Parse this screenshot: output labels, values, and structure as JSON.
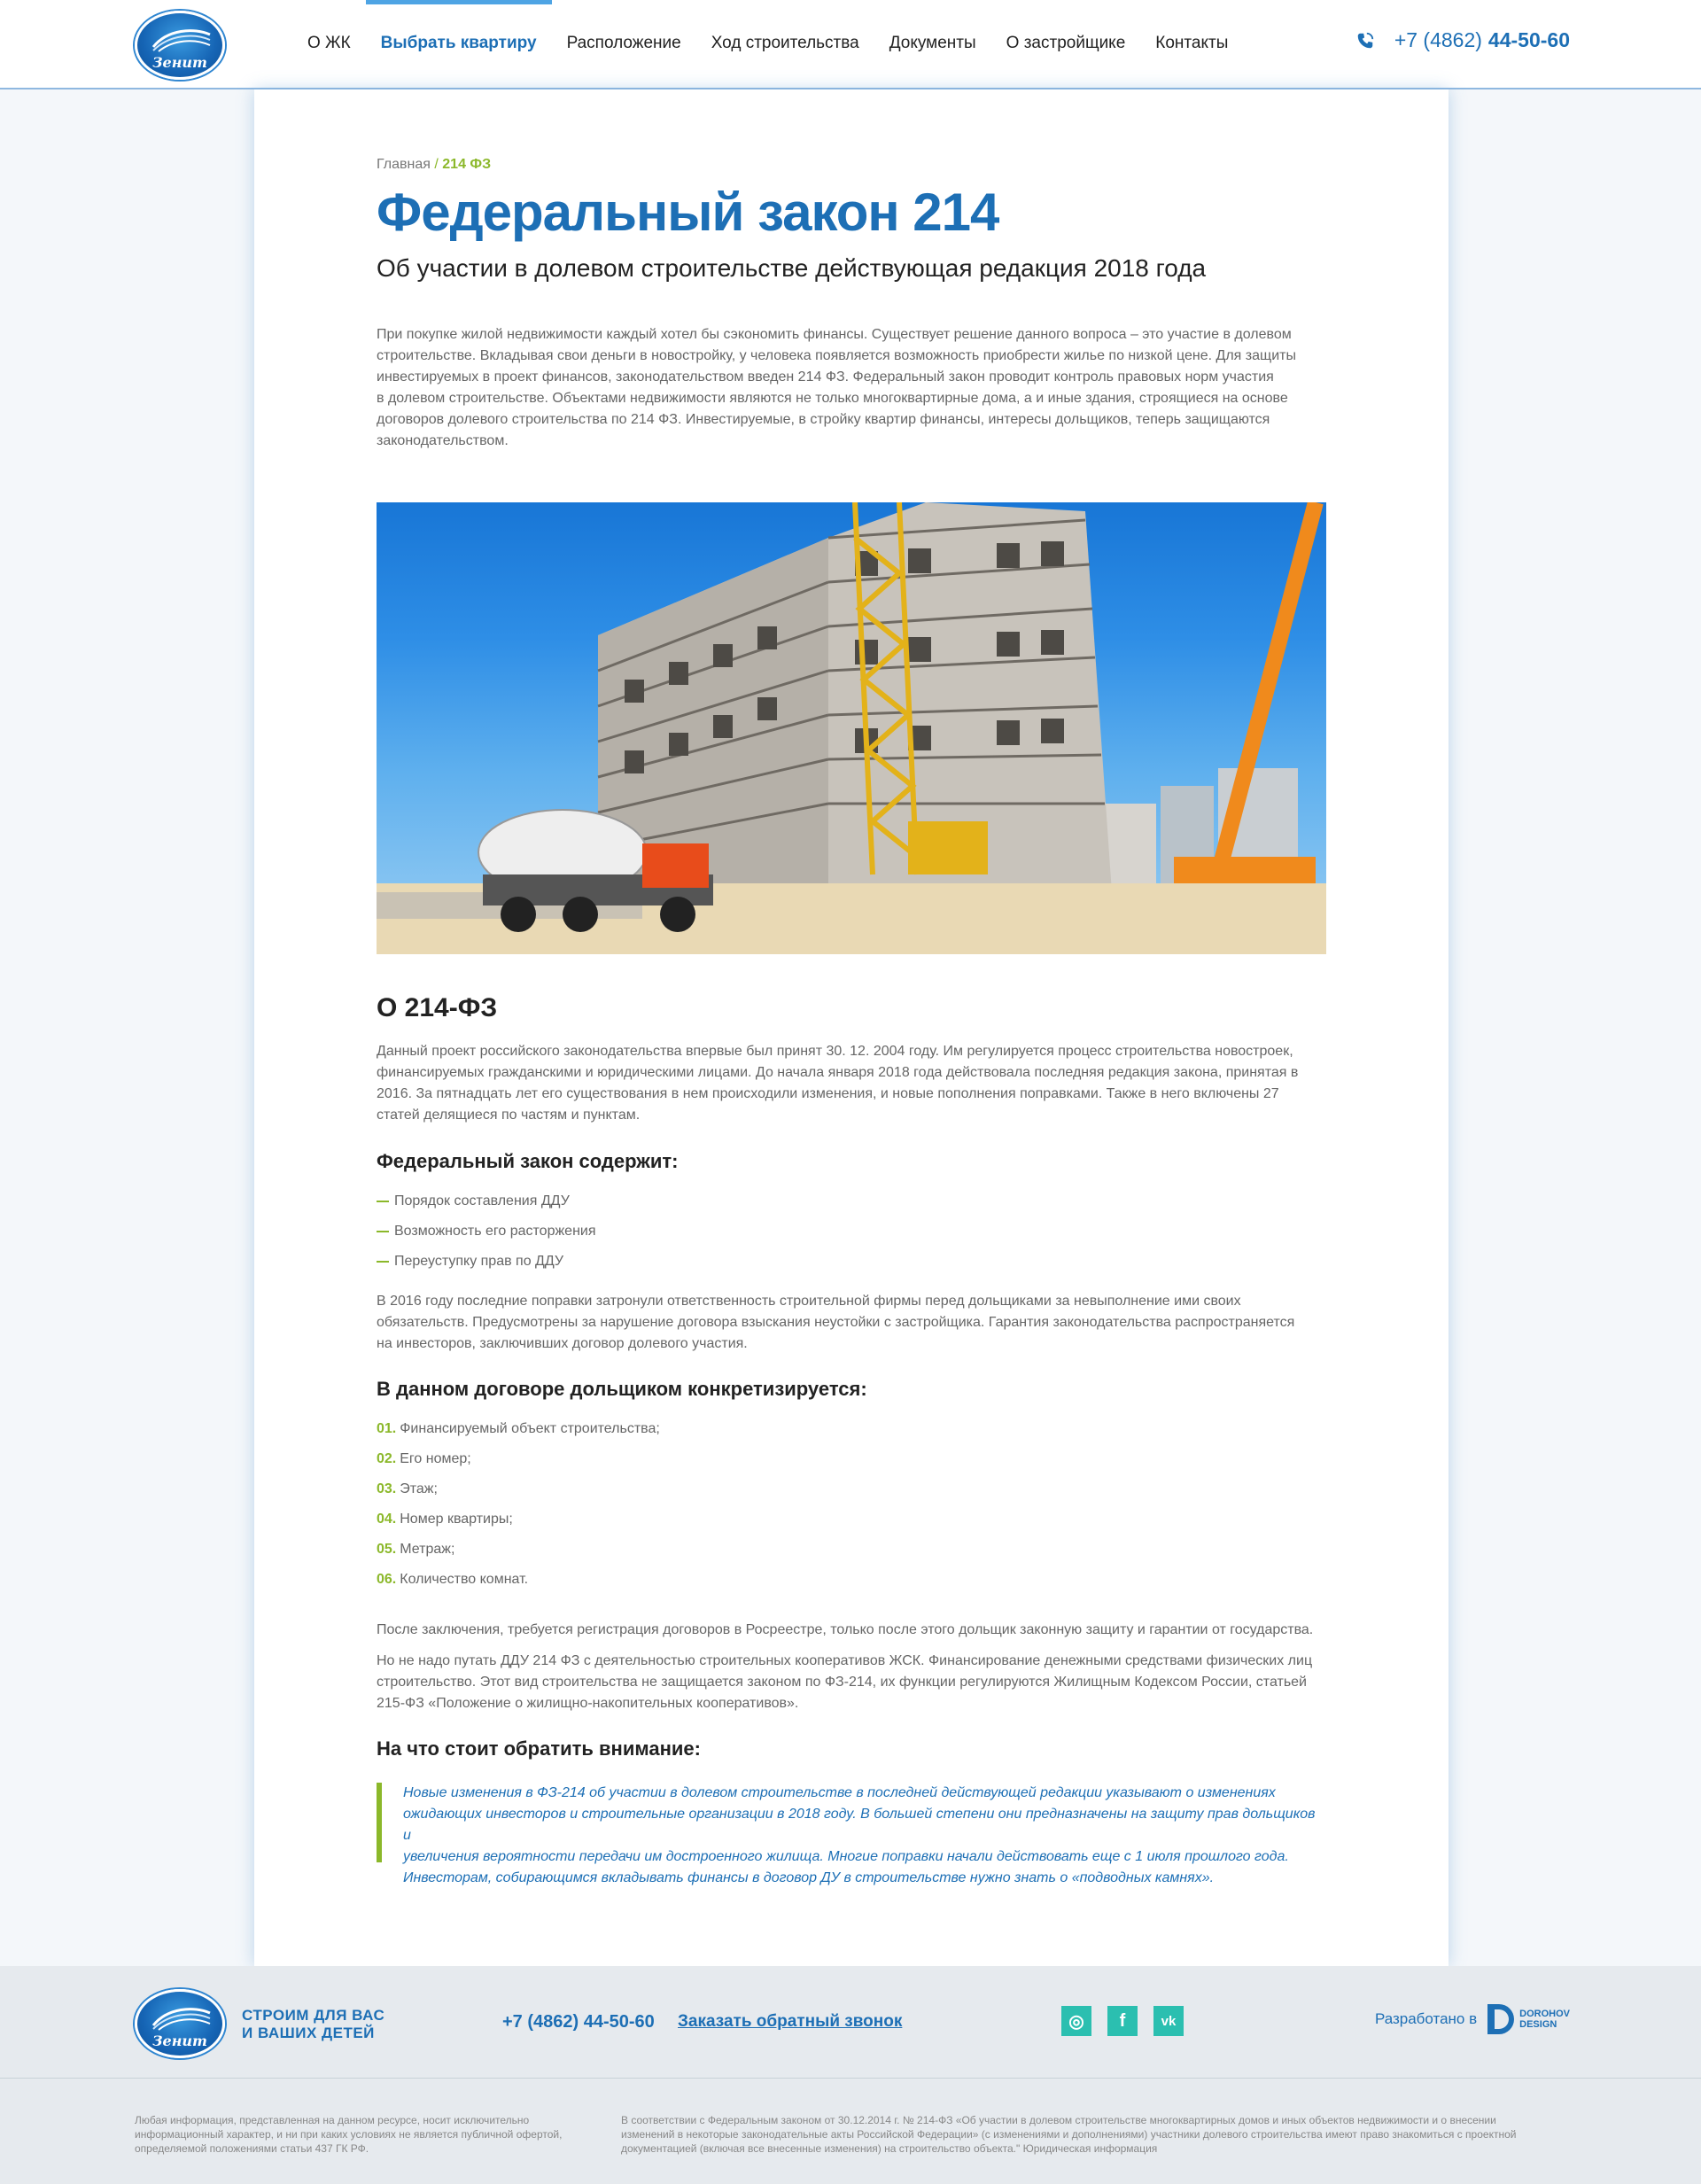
{
  "header": {
    "logo_text": "Зенит",
    "nav": [
      {
        "label": "О ЖК"
      },
      {
        "label": "Выбрать квартиру",
        "active": true
      },
      {
        "label": "Расположение"
      },
      {
        "label": "Ход строительства"
      },
      {
        "label": "Документы"
      },
      {
        "label": "О застройщике"
      },
      {
        "label": "Контакты"
      }
    ],
    "phone_prefix": "+7 (4862)",
    "phone_number": "44-50-60",
    "phone_icon": "phone-icon"
  },
  "breadcrumb": {
    "home": "Главная",
    "separator": "/",
    "current": "214 ФЗ"
  },
  "page": {
    "title": "Федеральный закон 214",
    "subtitle": "Об участии в долевом строительстве действующая редакция 2018 года",
    "intro": [
      "При покупке жилой недвижимости каждый хотел бы сэкономить финансы. Существует решение данного вопроса – это участие в долевом",
      "строительстве. Вкладывая свои деньги в новостройку, у человека появляется возможность приобрести жилье по низкой цене. Для защиты",
      "инвестируемых в проект финансов, законодательством введен 214 ФЗ. Федеральный закон проводит контроль правовых норм участия",
      "в долевом строительстве. Объектами недвижимости являются не только многоквартирные дома, а и иные здания, строящиеся на основе",
      "договоров долевого строительства по 214 ФЗ. Инвестируемые, в стройку квартир финансы, интересы дольщиков, теперь защищаются",
      "законодательством."
    ],
    "section_title": "О 214-ФЗ",
    "about": [
      "Данный проект российского законодательства впервые был принят 30. 12. 2004 году. Им регулируется процесс строительства новостроек,",
      "финансируемых гражданскими и юридическими лицами. До начала января 2018 года действовала последняя редакция закона, принятая в",
      "2016. За пятнадцать лет его существования в нем происходили изменения, и новые пополнения поправками. Также в него включены 27",
      "статей делящиеся по частям и пунктам."
    ],
    "contains_title": "Федеральный закон содержит:",
    "contains_items": [
      "Порядок составления ДДУ",
      "Возможность его расторжения",
      "Переуступку прав по ДДУ"
    ],
    "amendments": [
      "В 2016 году последние поправки затронули ответственность строительной фирмы перед дольщиками за невыполнение ими своих",
      "обязательств. Предусмотрены за нарушение договора взыскания неустойки с застройщика. Гарантия законодательства распространяется",
      "на инвесторов, заключивших договор долевого участия."
    ],
    "specifies_title": "В данном договоре дольщиком конкретизируется:",
    "specifies_items": [
      {
        "num": "01.",
        "text": "Финансируемый объект строительства;"
      },
      {
        "num": "02.",
        "text": "Его номер;"
      },
      {
        "num": "03.",
        "text": "Этаж;"
      },
      {
        "num": "04.",
        "text": "Номер квартиры;"
      },
      {
        "num": "05.",
        "text": "Метраж;"
      },
      {
        "num": "06.",
        "text": "Количество комнат."
      }
    ],
    "registration": "После заключения, требуется регистрация договоров в Росреестре, только после этого дольщик законную защиту и гарантии от государства.",
    "cooperatives": [
      "Но не надо путать ДДУ 214 ФЗ с деятельностью строительных кооперативов ЖСК. Финансирование денежными средствами физических лиц",
      "строительство. Этот вид строительства не защищается законом по ФЗ-214, их функции регулируются Жилищным Кодексом России, статьей",
      "215-ФЗ «Положение о жилищно-накопительных кооперативов»."
    ],
    "attention_title": "На что стоит обратить внимание:",
    "quote": [
      "Новые изменения в ФЗ-214 об участии в долевом строительстве в последней действующей редакции указывают о изменениях",
      "ожидающих инвесторов и строительные организации в 2018 году. В большей степени они предназначены на защиту прав дольщиков и",
      "увеличения вероятности передачи им достроенного жилища. Многие поправки начали действовать еще с 1 июля прошлого года.",
      "Инвесторам, собирающимся вкладывать финансы в договор ДУ в строительстве нужно знать о «подводных камнях»."
    ]
  },
  "footer": {
    "slogan_line1": "СТРОИМ ДЛЯ ВАС",
    "slogan_line2": "И ВАШИХ ДЕТЕЙ",
    "phone": "+7 (4862) 44-50-60",
    "callback": "Заказать обратный звонок",
    "socials": [
      {
        "icon": "instagram-icon",
        "glyph": "◎"
      },
      {
        "icon": "facebook-icon",
        "glyph": "f"
      },
      {
        "icon": "vk-icon",
        "glyph": "vk"
      }
    ],
    "developed_by": "Разработано в",
    "dev_name_1": "DOROHOV",
    "dev_name_2": "DESIGN",
    "legal_left": [
      "Любая информация, представленная на данном ресурсе, носит исключительно",
      "информационный характер, и ни при каких условиях не является публичной офертой,",
      "определяемой положениями статьи 437 ГК РФ."
    ],
    "legal_right": [
      "В соответствии с Федеральным законом от 30.12.2014 г. № 214-ФЗ «Об участии в долевом строительстве многоквартирных домов и иных объектов недвижимости и о внесении",
      "изменений в некоторые законодательные акты Российской Федерации» (с изменениями и дополнениями) участники долевого строительства имеют право знакомиться с проектной",
      "документацией (включая все внесенные изменения) на строительство объекта.\" Юридическая информация"
    ]
  },
  "colors": {
    "brand_blue": "#1d6fb5",
    "accent_green": "#8bb82a",
    "social_teal": "#2bbfb0"
  }
}
